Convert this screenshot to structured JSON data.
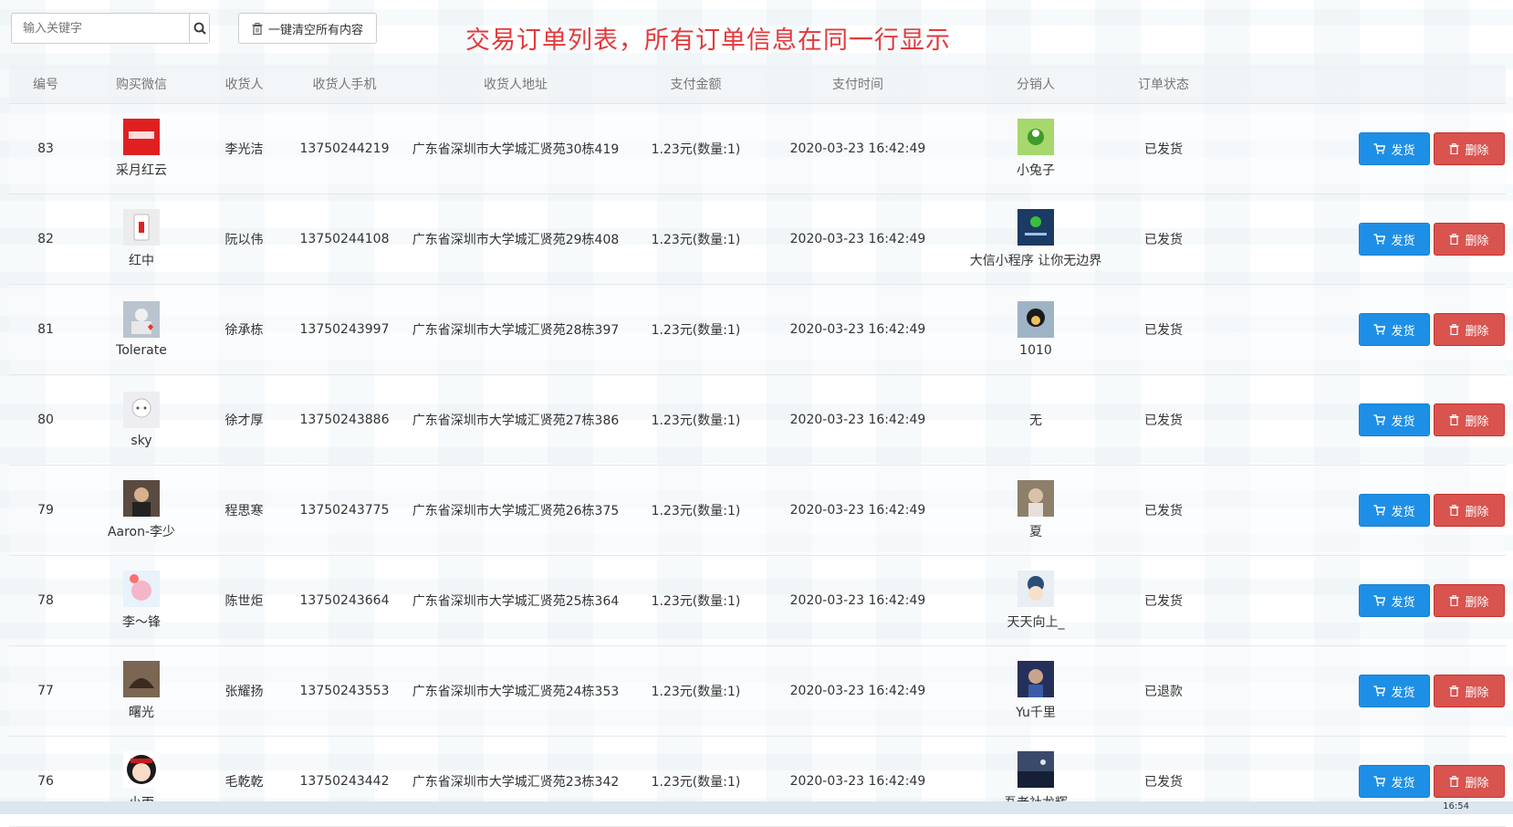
{
  "search": {
    "placeholder": "输入关键字"
  },
  "clear_all_label": "一键清空所有内容",
  "page_title": "交易订单列表，所有订单信息在同一行显示",
  "columns": [
    "编号",
    "购买微信",
    "收货人",
    "收货人手机",
    "收货人地址",
    "支付金额",
    "支付时间",
    "分销人",
    "订单状态"
  ],
  "actions": {
    "ship_label": "发货",
    "delete_label": "删除"
  },
  "orders": [
    {
      "id": "83",
      "buyer": "采月红云",
      "receiver": "李光洁",
      "phone": "13750244219",
      "address": "广东省深圳市大学城汇贤苑30栋419",
      "amount": "1.23元(数量:1)",
      "time": "2020-03-23 16:42:49",
      "distributor": "小兔子",
      "status": "已发货"
    },
    {
      "id": "82",
      "buyer": "红中",
      "receiver": "阮以伟",
      "phone": "13750244108",
      "address": "广东省深圳市大学城汇贤苑29栋408",
      "amount": "1.23元(数量:1)",
      "time": "2020-03-23 16:42:49",
      "distributor": "大信小程序 让你无边界",
      "status": "已发货"
    },
    {
      "id": "81",
      "buyer": "Tolerate",
      "receiver": "徐承栋",
      "phone": "13750243997",
      "address": "广东省深圳市大学城汇贤苑28栋397",
      "amount": "1.23元(数量:1)",
      "time": "2020-03-23 16:42:49",
      "distributor": "1010",
      "status": "已发货"
    },
    {
      "id": "80",
      "buyer": "sky",
      "receiver": "徐才厚",
      "phone": "13750243886",
      "address": "广东省深圳市大学城汇贤苑27栋386",
      "amount": "1.23元(数量:1)",
      "time": "2020-03-23 16:42:49",
      "distributor": "无",
      "status": "已发货"
    },
    {
      "id": "79",
      "buyer": "Aaron-李少",
      "receiver": "程思寒",
      "phone": "13750243775",
      "address": "广东省深圳市大学城汇贤苑26栋375",
      "amount": "1.23元(数量:1)",
      "time": "2020-03-23 16:42:49",
      "distributor": "夏",
      "status": "已发货"
    },
    {
      "id": "78",
      "buyer": "李～锋",
      "receiver": "陈世炬",
      "phone": "13750243664",
      "address": "广东省深圳市大学城汇贤苑25栋364",
      "amount": "1.23元(数量:1)",
      "time": "2020-03-23 16:42:49",
      "distributor": "天天向上_",
      "status": "已发货"
    },
    {
      "id": "77",
      "buyer": "曙光",
      "receiver": "张耀扬",
      "phone": "13750243553",
      "address": "广东省深圳市大学城汇贤苑24栋353",
      "amount": "1.23元(数量:1)",
      "time": "2020-03-23 16:42:49",
      "distributor": "Yu千里",
      "status": "已退款"
    },
    {
      "id": "76",
      "buyer": "小丙",
      "receiver": "毛乾乾",
      "phone": "13750243442",
      "address": "广东省深圳市大学城汇贤苑23栋342",
      "amount": "1.23元(数量:1)",
      "time": "2020-03-23 16:42:49",
      "distributor": "吾老社龙辉",
      "status": "已发货"
    }
  ],
  "taskbar": {
    "clock": "16:54"
  },
  "colors": {
    "title_red": "#e4393c",
    "ship_blue": "#1e8fe6",
    "delete_red": "#d9534f"
  }
}
